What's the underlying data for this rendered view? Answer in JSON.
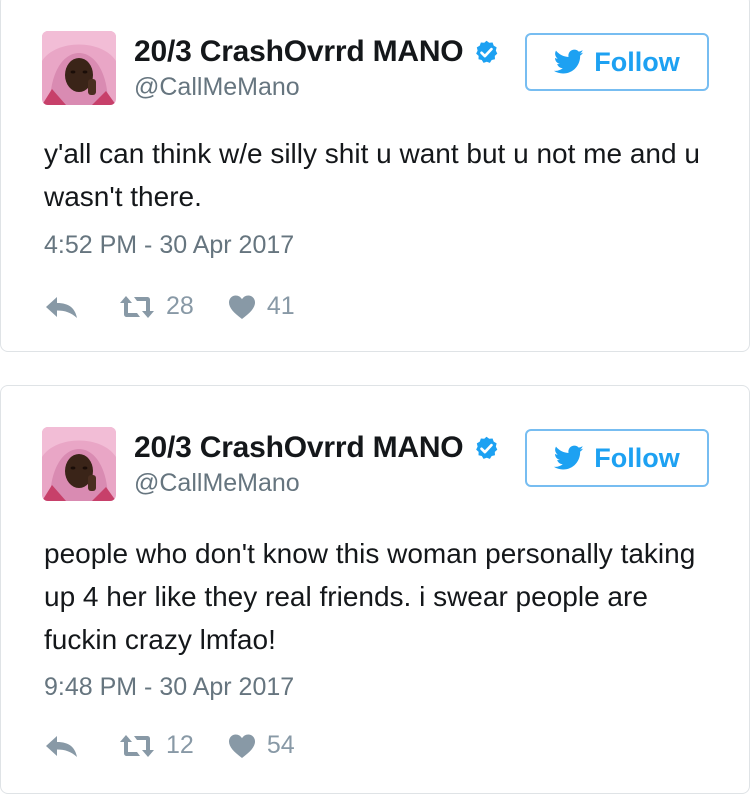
{
  "tweets": [
    {
      "display_name": "20/3 CrashOvrrd MANO",
      "handle": "@CallMeMano",
      "follow_label": "Follow",
      "text": "y'all can think w/e silly shit u want but u not me and u wasn't there.",
      "timestamp": "4:52 PM - 30 Apr 2017",
      "retweets": "28",
      "likes": "41"
    },
    {
      "display_name": "20/3 CrashOvrrd MANO",
      "handle": "@CallMeMano",
      "follow_label": "Follow",
      "text": "people who don't know this woman personally taking up 4 her like they real friends. i swear people are fuckin crazy lmfao!",
      "timestamp": "9:48 PM - 30 Apr 2017",
      "retweets": "12",
      "likes": "54"
    }
  ],
  "colors": {
    "brand_blue": "#1da1f2",
    "follow_border": "#77bdf1",
    "secondary_text": "#66757f",
    "action_icon": "#8899a6",
    "card_border": "#dfe3e6"
  },
  "icons": [
    "avatar",
    "verified-badge-icon",
    "twitter-bird-icon",
    "reply-icon",
    "retweet-icon",
    "heart-icon"
  ]
}
